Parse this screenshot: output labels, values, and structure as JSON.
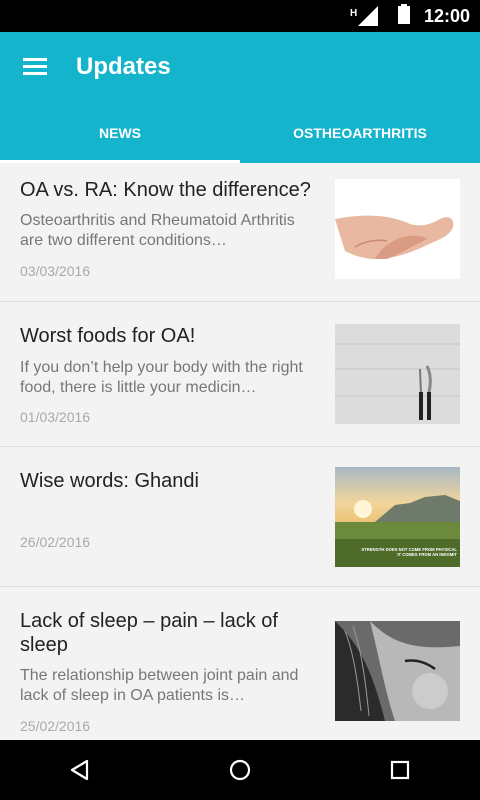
{
  "status": {
    "time": "12:00",
    "network": "H"
  },
  "appbar": {
    "title": "Updates"
  },
  "tabs": [
    {
      "label": "NEWS",
      "active": true
    },
    {
      "label": "OSTHEOARTHRITIS",
      "active": false
    }
  ],
  "articles": [
    {
      "title": "OA vs. RA: Know the difference?",
      "description": "Osteoarthritis and Rheumatoid Arthritis are two different conditions…",
      "date": "03/03/2016",
      "image": "hands-image"
    },
    {
      "title": "Worst foods for OA!",
      "description": "If you don’t help your body with the right food, there is little your medicin…",
      "date": "01/03/2016",
      "image": "fork-knife-image"
    },
    {
      "title": "Wise words: Ghandi",
      "description": "",
      "date": "26/02/2016",
      "image": "landscape-quote-image",
      "image_text": [
        "STRENGTH DOES NOT COME FROM PHYSICAL",
        "IT COMES FROM AN INDOMIT"
      ]
    },
    {
      "title": "Lack of sleep – pain – lack of sleep",
      "description": "The relationship between joint pain and lack of sleep in OA patients is…",
      "date": "25/02/2016",
      "image": "sleeping-face-image"
    }
  ],
  "colors": {
    "primary": "#14b4cc",
    "background": "#f3f3f3"
  }
}
